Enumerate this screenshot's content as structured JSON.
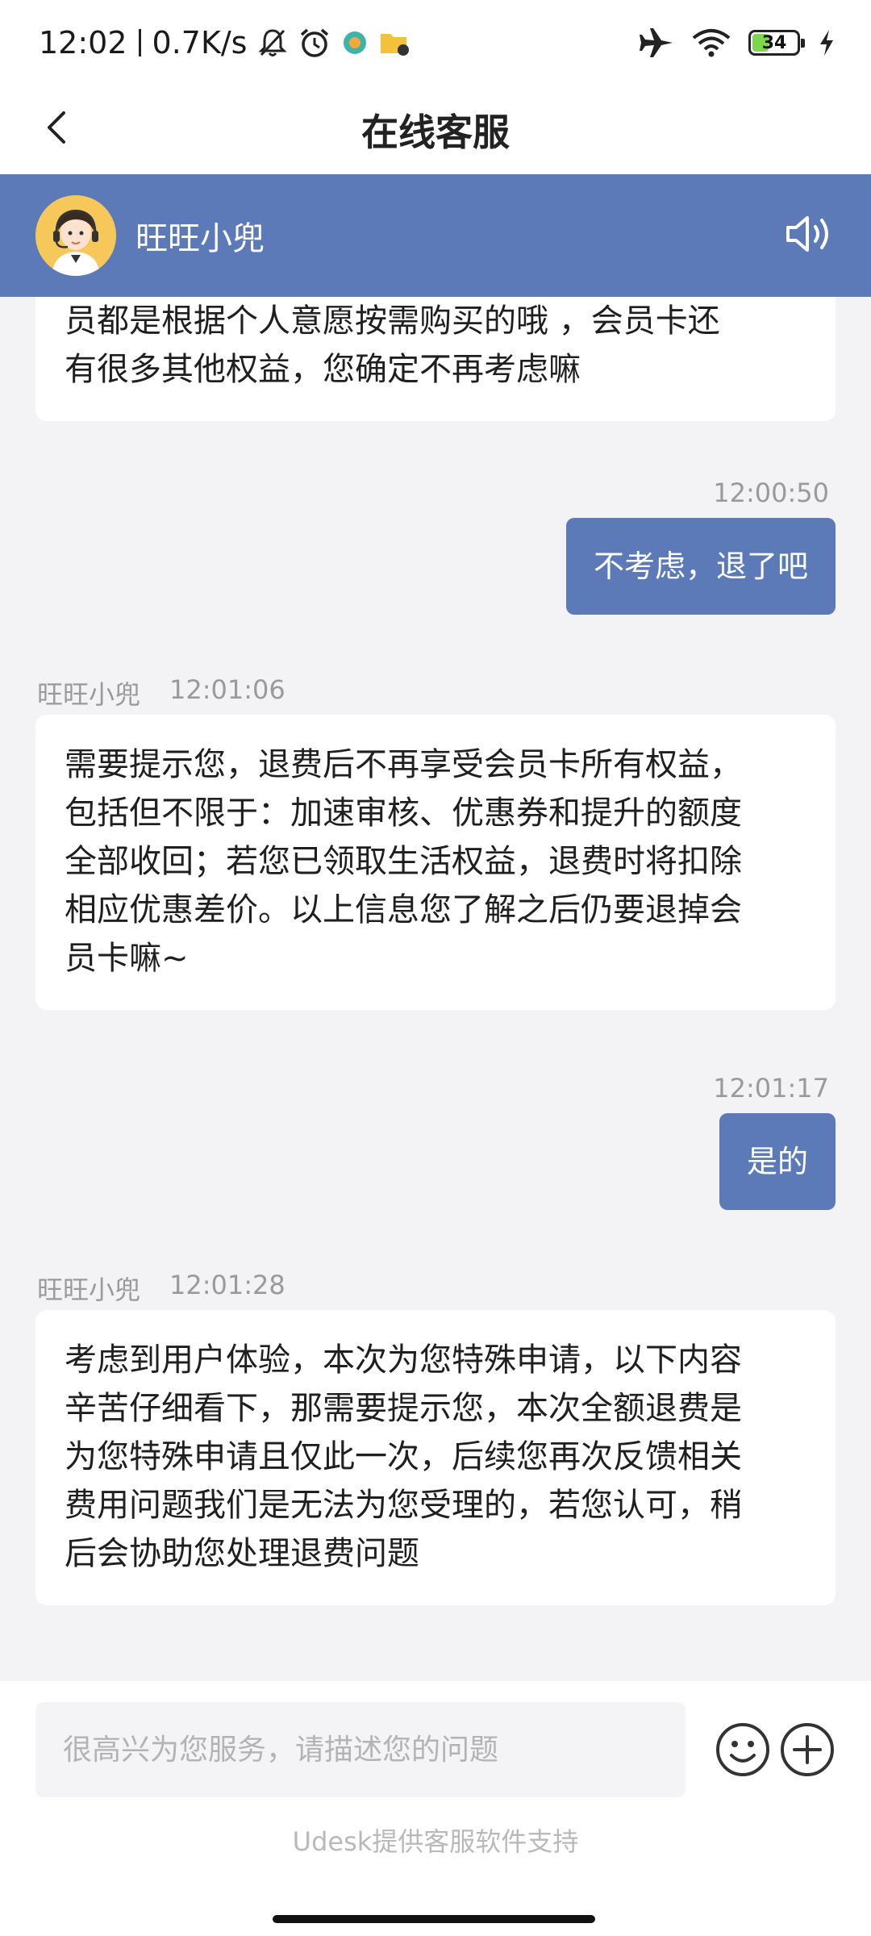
{
  "status_bar": {
    "time": "12:02",
    "network_speed": "0.7K/s",
    "battery_level": "34",
    "battery_percent": 34,
    "icons": [
      "mute-bell-icon",
      "alarm-icon",
      "app-notification-icon",
      "folder-notification-icon",
      "airplane-icon",
      "wifi-icon",
      "battery-icon",
      "charging-icon"
    ]
  },
  "header": {
    "title": "在线客服",
    "back_icon": "back-chevron-icon"
  },
  "agent": {
    "name": "旺旺小兜",
    "speaker_icon": "speaker-icon"
  },
  "messages": [
    {
      "sender": "agent",
      "lines": [
        "员都是根据个人意愿按需购买的哦 ，会员卡还",
        "有很多其他权益，您确定不再考虑嘛"
      ]
    },
    {
      "sender": "user",
      "time": "12:00:50",
      "text": "不考虑，退了吧"
    },
    {
      "sender": "agent",
      "name": "旺旺小兜",
      "time": "12:01:06",
      "lines": [
        "需要提示您，退费后不再享受会员卡所有权益，",
        "包括但不限于：加速审核、优惠券和提升的额度",
        "全部收回；若您已领取生活权益，退费时将扣除",
        "相应优惠差价。以上信息您了解之后仍要退掉会",
        "员卡嘛~"
      ]
    },
    {
      "sender": "user",
      "time": "12:01:17",
      "text": "是的"
    },
    {
      "sender": "agent",
      "name": "旺旺小兜",
      "time": "12:01:28",
      "lines": [
        "考虑到用户体验，本次为您特殊申请，以下内容",
        "辛苦仔细看下，那需要提示您，本次全额退费是",
        "为您特殊申请且仅此一次，后续您再次反馈相关",
        "费用问题我们是无法为您受理的，若您认可，稍",
        "后会协助您处理退费问题"
      ]
    }
  ],
  "input": {
    "placeholder": "很高兴为您服务，请描述您的问题",
    "value": ""
  },
  "footer": {
    "powered_by": "Udesk提供客服软件支持"
  },
  "colors": {
    "accent": "#5d7ab8",
    "background": "#f3f3f5"
  }
}
